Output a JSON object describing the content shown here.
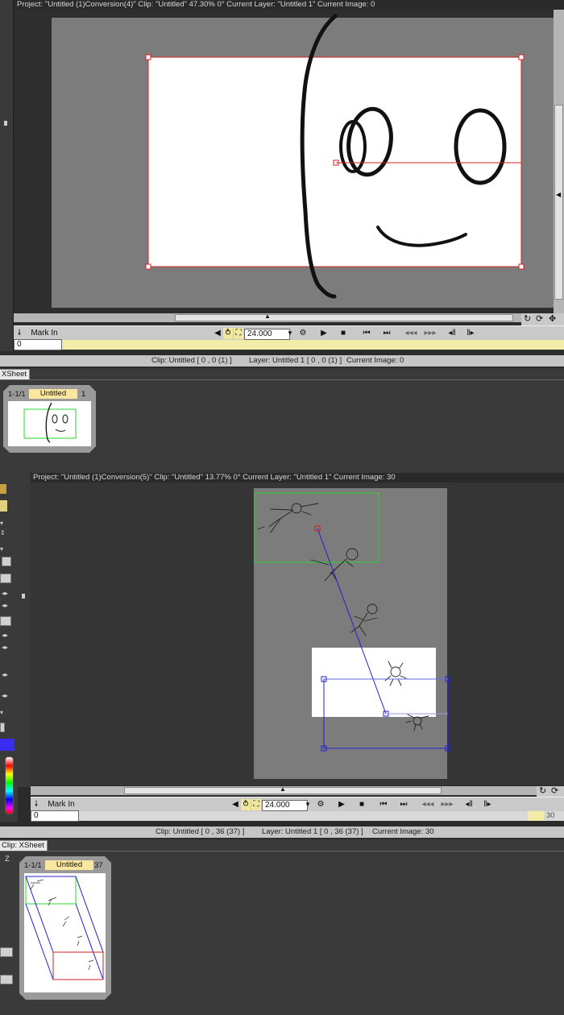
{
  "panel1": {
    "title": "Project:  \"Untitled (1)Conversion(4)\"  Clip: \"Untitled\"   47.30%   0°   Current Layer: \"Untitled 1\"   Current Image: 0",
    "mark_in": "Mark In",
    "fps": "24.000",
    "frame_input": "0",
    "status_clip": "Clip: Untitled [ 0 , 0  (1) ]",
    "status_layer": "Layer: Untitled 1 [ 0 , 0  (1) ]",
    "status_image": "Current Image: 0",
    "xsheet_tab": "XSheet",
    "xsheet_range": "1-1/1",
    "xsheet_name": "Untitled",
    "xsheet_count": "1"
  },
  "panel2": {
    "title": "Project:  \"Untitled (1)Conversion(5)\"  Clip: \"Untitled\"   13.77%   0°   Current Layer: \"Untitled 1\"   Current Image: 30",
    "mark_in": "Mark In",
    "fps": "24.000",
    "frame_input": "0",
    "frame_marker": "30",
    "status_clip": "Clip: Untitled [ 0 , 36  (37) ]",
    "status_layer": "Layer: Untitled 1 [ 0 , 36  (37) ]",
    "status_image": "Current Image: 30",
    "xsheet_tab": "Clip: XSheet",
    "xsheet_range": "1-1/1",
    "xsheet_name": "Untitled",
    "xsheet_count": "37"
  },
  "side_letter": "Z",
  "colors": {
    "frame_red": "#d42020",
    "camera_green": "#2bd42b",
    "path_blue": "#2020d0",
    "timeline_yellow": "#f3eca8",
    "xsheet_tab_yellow": "#fbe6a0"
  }
}
